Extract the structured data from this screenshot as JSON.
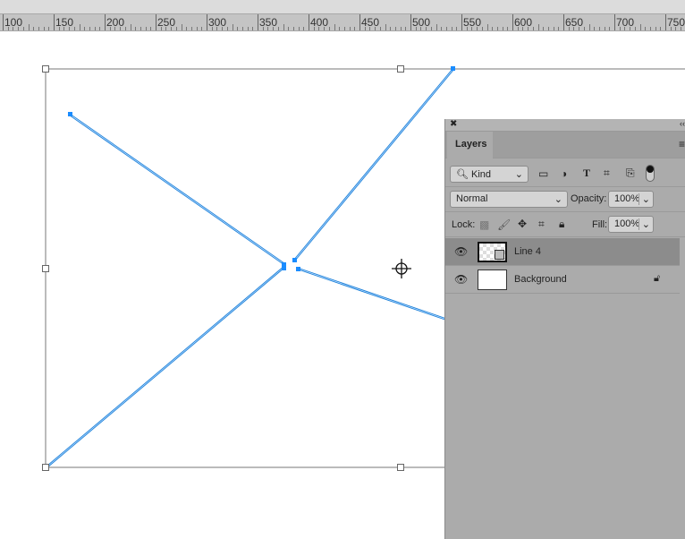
{
  "ruler": {
    "labels": [
      "100",
      "150",
      "200",
      "250",
      "300",
      "350",
      "400",
      "450",
      "500",
      "550",
      "600",
      "650",
      "700",
      "750"
    ]
  },
  "accent": "#1a8cff",
  "panel": {
    "tab": "Layers",
    "filter": {
      "value": "Kind",
      "icons": [
        "image-filter-icon",
        "adjustment-filter-icon",
        "type-filter-icon",
        "shape-filter-icon",
        "smart-object-filter-icon",
        "filter-toggle-icon"
      ]
    },
    "blend_mode": "Normal",
    "opacity_label": "Opacity:",
    "opacity": "100%",
    "lock_label": "Lock:",
    "fill_label": "Fill:",
    "fill": "100%",
    "layers": [
      {
        "name": "Line 4",
        "selected": true,
        "visible": true
      },
      {
        "name": "Background",
        "selected": false,
        "visible": true,
        "locked": true
      }
    ]
  }
}
